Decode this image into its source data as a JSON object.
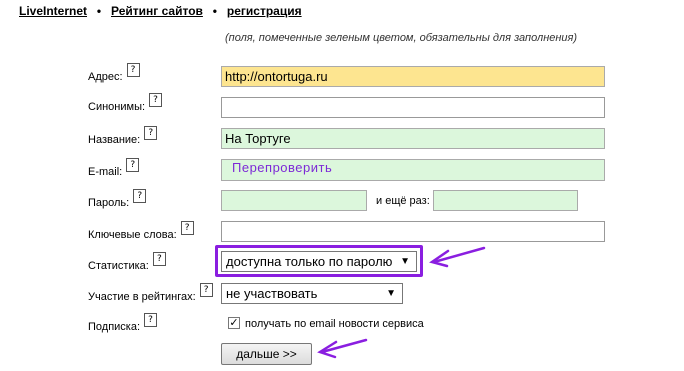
{
  "nav": {
    "items": [
      "LiveInternet",
      "Рейтинг сайтов",
      "регистрация"
    ],
    "separator": "•"
  },
  "note": "(поля, помеченные зеленым цветом, обязательны для заполнения)",
  "help_glyph": "?",
  "form": {
    "address": {
      "label": "Адрес:",
      "value": "http://ontortuga.ru"
    },
    "synonyms": {
      "label": "Синонимы:",
      "value": ""
    },
    "name": {
      "label": "Название:",
      "value": "На Тортуге"
    },
    "email": {
      "label": "E-mail:",
      "value": "Перепроверить"
    },
    "password": {
      "label": "Пароль:",
      "value": "",
      "again_label": "и ещё раз:",
      "again_value": ""
    },
    "keywords": {
      "label": "Ключевые слова:",
      "value": ""
    },
    "stats": {
      "label": "Статистика:",
      "selected": "доступна только по паролю"
    },
    "ratings": {
      "label": "Участие в рейтингах:",
      "selected": "не участвовать"
    },
    "subscription": {
      "label": "Подписка:",
      "checked": true,
      "check_glyph": "✓",
      "text": "получать по email новости сервиса"
    },
    "next_button": "дальше >>"
  },
  "colors": {
    "required_green": "#dcf7dc",
    "address_yellow": "#fde590",
    "annotation_purple": "#8a1ee0",
    "email_text": "#7d2ad6"
  }
}
